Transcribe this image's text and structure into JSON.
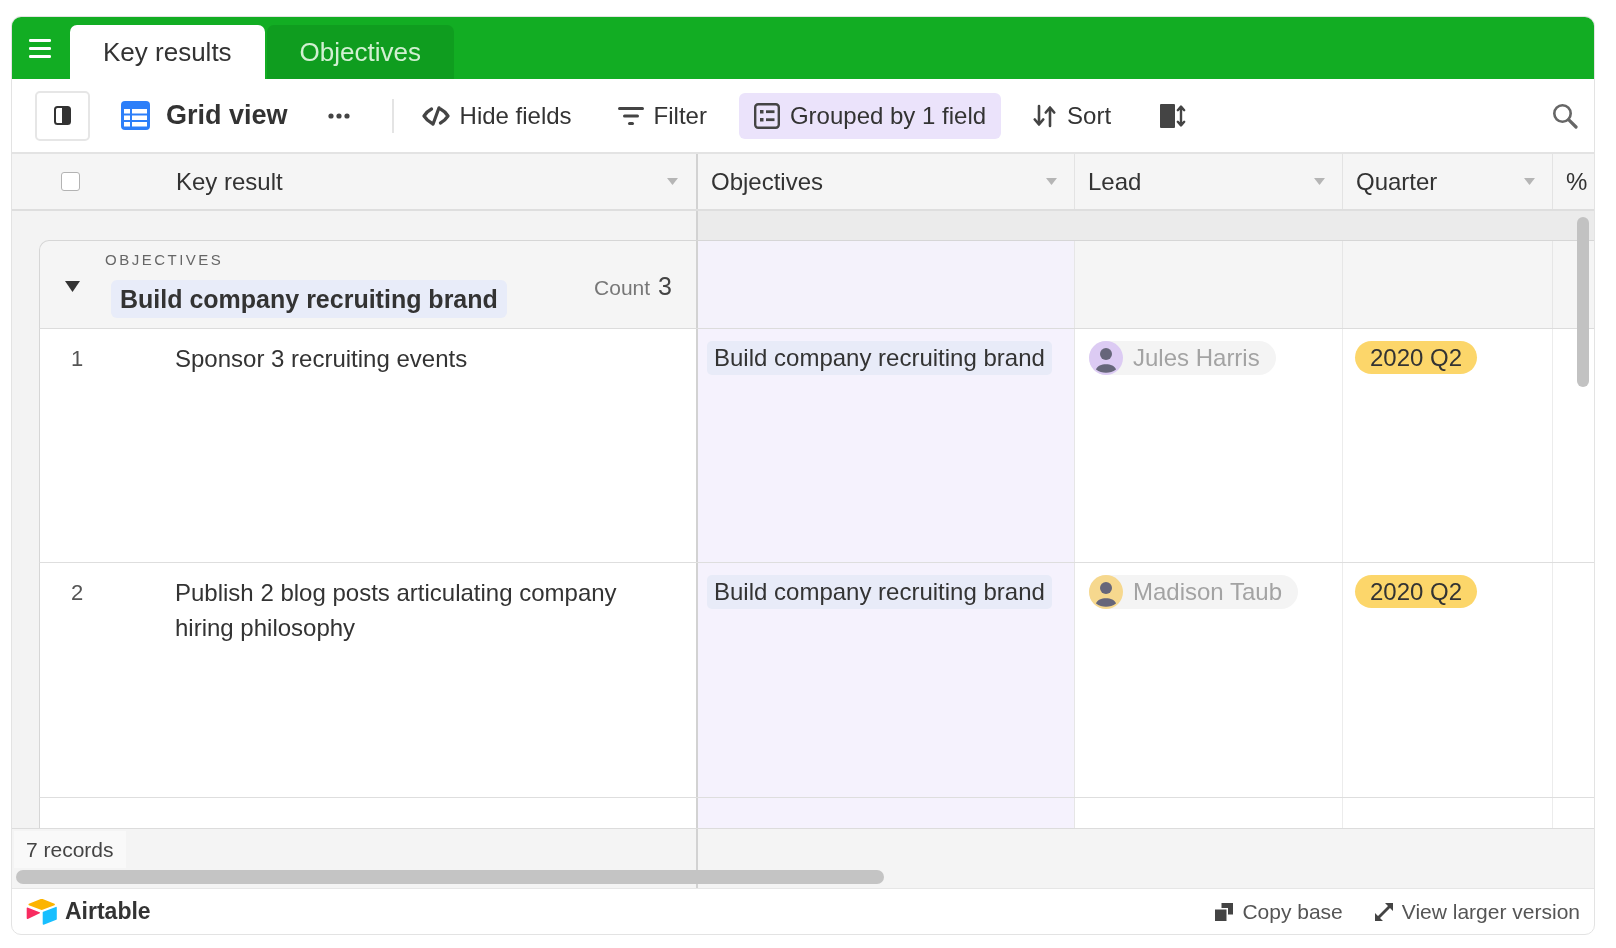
{
  "header": {
    "tabs": [
      {
        "label": "Key results",
        "selected": true
      },
      {
        "label": "Objectives",
        "selected": false
      }
    ]
  },
  "toolbar": {
    "view": {
      "label": "Grid view"
    },
    "tools": [
      {
        "label": "Hide fields",
        "on": false
      },
      {
        "label": "Filter",
        "on": false
      },
      {
        "label": "Grouped by 1 field",
        "on": true
      },
      {
        "label": "Sort",
        "on": false
      }
    ]
  },
  "table": {
    "header_checkbox": {
      "checked": false
    },
    "columns": [
      {
        "label": "Key result"
      },
      {
        "label": "Objectives"
      },
      {
        "label": "Lead"
      },
      {
        "label": "Quarter"
      },
      {
        "label": "%"
      }
    ],
    "groups": [
      {
        "field": "OBJECTIVES",
        "value": "Build company recruiting brand",
        "count_label": "Count",
        "count": "3",
        "expanded": true,
        "rows": [
          {
            "number": "1",
            "key_result": "Sponsor 3 recruiting events",
            "objective": "Build company recruiting brand",
            "lead": {
              "name": "Jules Harris",
              "color": "#dccbf3"
            },
            "quarter": "2020 Q2"
          },
          {
            "number": "2",
            "key_result": "Publish 2 blog posts articulating company hiring philosophy",
            "objective": "Build company recruiting brand",
            "lead": {
              "name": "Madison Taub",
              "color": "#f6d88e"
            },
            "quarter": "2020 Q2"
          }
        ]
      }
    ]
  },
  "summary": {
    "records": "7 records"
  },
  "footer": {
    "brand": "Airtable",
    "actions": [
      {
        "label": "Copy base"
      },
      {
        "label": "View larger version"
      }
    ]
  }
}
